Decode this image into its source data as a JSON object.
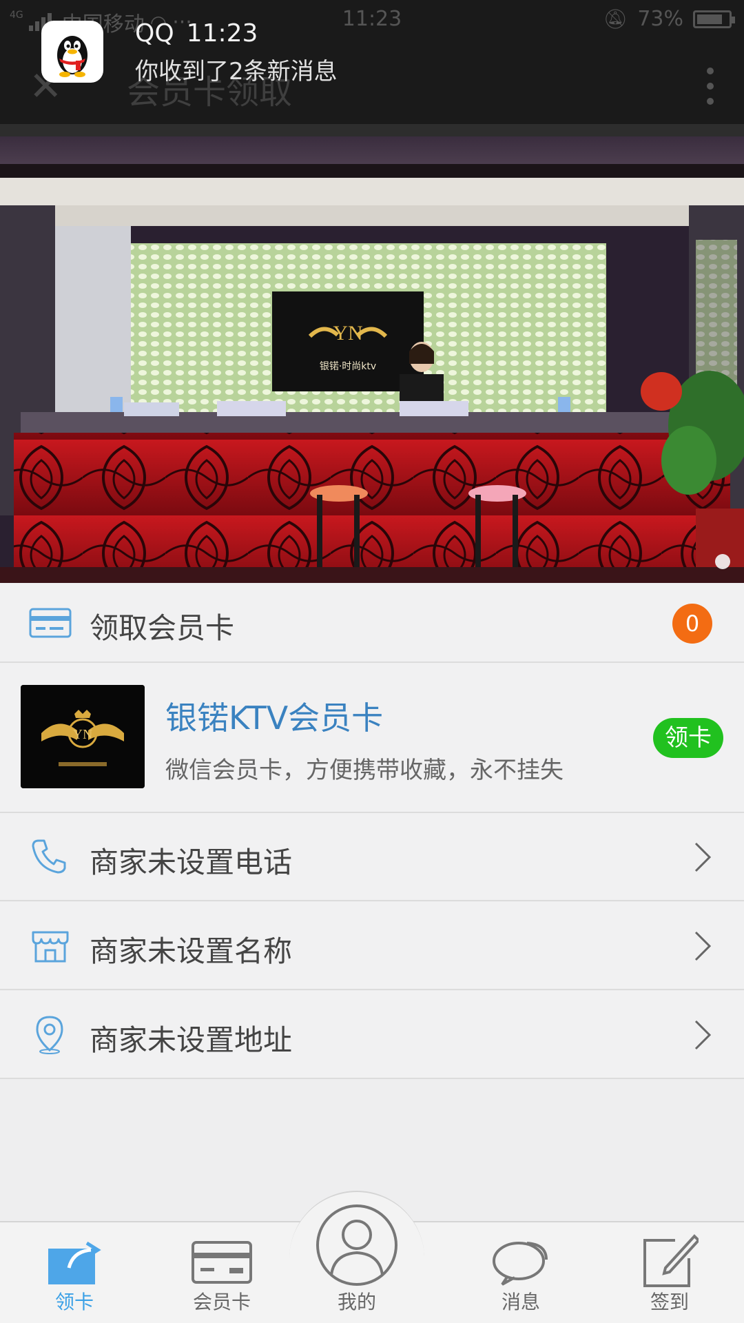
{
  "status_bar": {
    "carrier": "中国移动",
    "network": "4G",
    "time": "11:23",
    "battery": "73%"
  },
  "header": {
    "title": "会员卡领取",
    "close_icon": "close-icon",
    "more_icon": "more-vert-icon"
  },
  "notification": {
    "app": "QQ",
    "time": "11:23",
    "message": "你收到了2条新消息"
  },
  "banner": {
    "logo_text": "YN",
    "sign_text": "银锘·时尚ktv"
  },
  "claim_section": {
    "label": "领取会员卡",
    "count": "0"
  },
  "card": {
    "title": "银锘KTV会员卡",
    "description": "微信会员卡，方便携带收藏，永不挂失",
    "button": "领卡"
  },
  "info_rows": [
    {
      "label": "商家未设置电话",
      "icon": "phone-icon"
    },
    {
      "label": "商家未设置名称",
      "icon": "store-icon"
    },
    {
      "label": "商家未设置地址",
      "icon": "location-pin-icon"
    }
  ],
  "bottom_nav": [
    {
      "label": "领卡",
      "icon": "claim-card-icon",
      "active": true
    },
    {
      "label": "会员卡",
      "icon": "member-card-icon",
      "active": false
    },
    {
      "label": "我的",
      "icon": "user-icon",
      "active": false
    },
    {
      "label": "消息",
      "icon": "chat-icon",
      "active": false
    },
    {
      "label": "签到",
      "icon": "sign-in-icon",
      "active": false
    }
  ],
  "colors": {
    "accent_blue": "#3a82c0",
    "badge_orange": "#f36c13",
    "button_green": "#21c11f",
    "active_tab": "#3aa0e6"
  }
}
